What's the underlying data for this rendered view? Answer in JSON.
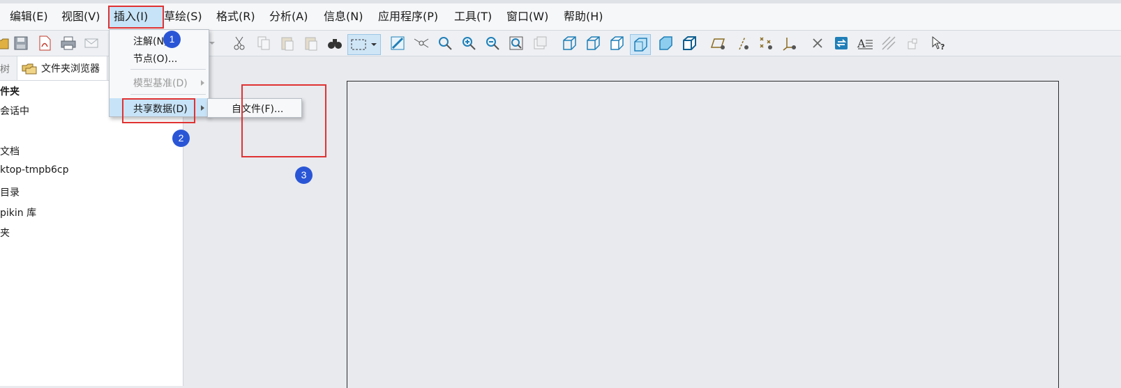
{
  "menubar": {
    "items": [
      {
        "label": "编辑(E)"
      },
      {
        "label": "视图(V)"
      },
      {
        "label": "插入(I)"
      },
      {
        "label": "草绘(S)"
      },
      {
        "label": "格式(R)"
      },
      {
        "label": "分析(A)"
      },
      {
        "label": "信息(N)"
      },
      {
        "label": "应用程序(P)"
      },
      {
        "label": "工具(T)"
      },
      {
        "label": "窗口(W)"
      },
      {
        "label": "帮助(H)"
      }
    ]
  },
  "insert_menu": {
    "items": [
      {
        "label": "注解(N)..."
      },
      {
        "label": "节点(O)..."
      },
      {
        "label": "模型基准(D)"
      },
      {
        "label": "共享数据(D)"
      }
    ]
  },
  "shared_data_submenu": {
    "items": [
      {
        "label": "自文件(F)..."
      }
    ]
  },
  "left_panel": {
    "tab_partial": "树",
    "tab_browser": "文件夹浏览器",
    "tree": [
      {
        "label": "件夹"
      },
      {
        "label": "会话中"
      },
      {
        "label": "文档"
      },
      {
        "label": "ktop-tmpb6cp"
      },
      {
        "label": "目录"
      },
      {
        "label": "pikin 库"
      },
      {
        "label": "夹"
      }
    ]
  },
  "badges": [
    "1",
    "2",
    "3"
  ],
  "colors": {
    "highlight": "#c7e3f7",
    "annotation_red": "#e03232",
    "badge_blue": "#2a56d6"
  }
}
